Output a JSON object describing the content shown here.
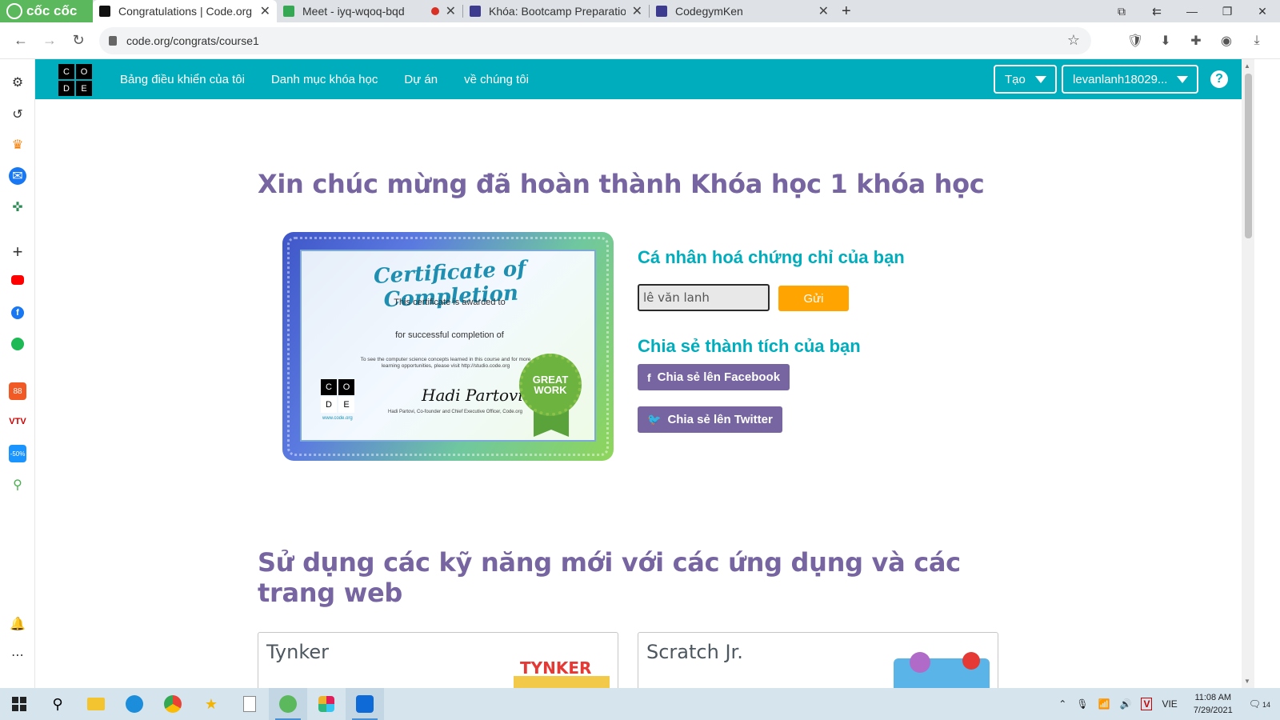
{
  "browser": {
    "brand": "cốc cốc",
    "tabs": [
      {
        "title": "Congratulations | Code.org",
        "active": true
      },
      {
        "title": "Meet - iyq-wqoq-bqd",
        "recording": true
      },
      {
        "title": "Khóa: Bootcamp Preparation"
      },
      {
        "title": "CodegymKen"
      }
    ],
    "new_tab": "+",
    "url": "code.org/congrats/course1"
  },
  "header": {
    "nav": [
      "Bảng điều khiển của tôi",
      "Danh mục khóa học",
      "Dự án",
      "về chúng tôi"
    ],
    "create_label": "Tạo",
    "user_label": "levanlanh18029...",
    "help": "?"
  },
  "logo": [
    "C",
    "O",
    "D",
    "E"
  ],
  "congrats": {
    "title": "Xin chúc mừng đã hoàn thành Khóa học 1 khóa học"
  },
  "certificate": {
    "heading": "Certificate of Completion",
    "awarded": "This certificate is awarded to",
    "completion": "for successful completion of",
    "note": "To see the computer science concepts learned in this course and for more learning opportunities, please visit http://studio.code.org",
    "url": "www.code.org",
    "signature": "Hadi Partovi",
    "signature_caption": "Hadi Partovi, Co-founder and Chief Executive Officer, Code.org",
    "badge": "GREAT WORK"
  },
  "personalize": {
    "heading": "Cá nhân hoá chứng chỉ của bạn",
    "name_value": "lê văn lanh",
    "submit_label": "Gửi"
  },
  "share": {
    "heading": "Chia sẻ thành tích của bạn",
    "facebook_label": "Chia sẻ lên Facebook",
    "twitter_label": "Chia sẻ lên Twitter"
  },
  "apps": {
    "heading": "Sử dụng các kỹ năng mới với các ứng dụng và các trang web",
    "cards": [
      {
        "title": "Tynker",
        "logo_text": "TYNKER"
      },
      {
        "title": "Scratch Jr."
      }
    ]
  },
  "taskbar": {
    "language": "VIE",
    "time": "11:08 AM",
    "date": "7/29/2021",
    "notifications": "14"
  }
}
